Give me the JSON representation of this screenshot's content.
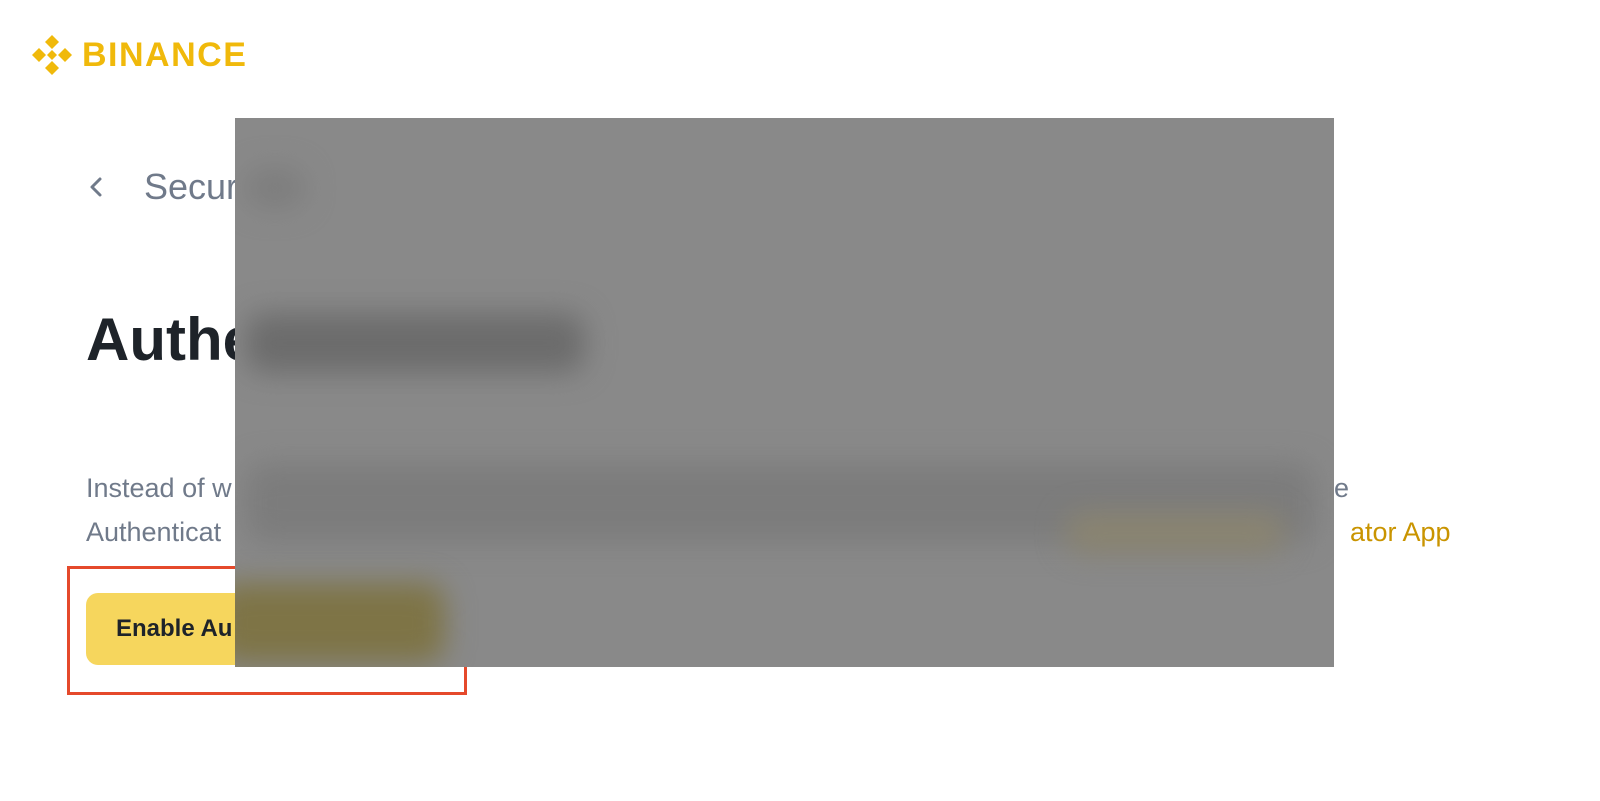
{
  "brand": {
    "name": "BINANCE",
    "color": "#F0B90B"
  },
  "nav": {
    "back_icon": "chevron-left-icon",
    "back_label": "Secur"
  },
  "page": {
    "title": "Authe",
    "description_line1_start": "Instead of w",
    "description_line1_end": "e",
    "description_line2_start": "Authenticat",
    "description_link_fragment": "ator App"
  },
  "actions": {
    "enable_button_label": "Enable Au"
  },
  "colors": {
    "title_text": "#1E2329",
    "secondary_text": "#707A8A",
    "link": "#C99400",
    "button_bg": "#F6D65D",
    "highlight_border": "#E5492B",
    "redaction": "#898989"
  }
}
